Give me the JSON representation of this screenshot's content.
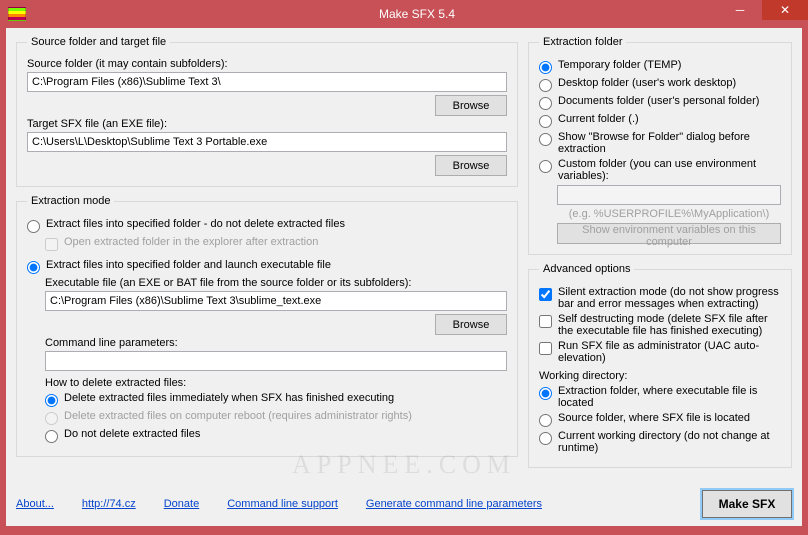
{
  "window": {
    "title": "Make SFX 5.4"
  },
  "source_target": {
    "legend": "Source folder and target file",
    "source_label": "Source folder (it may contain subfolders):",
    "source_value": "C:\\Program Files (x86)\\Sublime Text 3\\",
    "target_label": "Target SFX file (an EXE file):",
    "target_value": "C:\\Users\\L\\Desktop\\Sublime Text 3 Portable.exe",
    "browse": "Browse"
  },
  "extraction_mode": {
    "legend": "Extraction mode",
    "opt_nodelete": "Extract files into specified folder - do not delete extracted files",
    "open_after": "Open extracted folder in the explorer after extraction",
    "opt_launch": "Extract files into specified folder and launch executable file",
    "exe_label": "Executable file (an EXE or BAT file from the source folder or its subfolders):",
    "exe_value": "C:\\Program Files (x86)\\Sublime Text 3\\sublime_text.exe",
    "cmd_label": "Command line parameters:",
    "cmd_value": "",
    "browse": "Browse",
    "howto_label": "How to delete extracted files:",
    "del_immediately": "Delete extracted files immediately when SFX has finished executing",
    "del_reboot": "Delete extracted files on computer reboot (requires administrator rights)",
    "del_no": "Do not delete extracted files"
  },
  "extraction_folder": {
    "legend": "Extraction folder",
    "temp": "Temporary folder (TEMP)",
    "desktop": "Desktop folder (user's work desktop)",
    "documents": "Documents folder (user's personal folder)",
    "current": "Current folder (.)",
    "browse_dialog": "Show \"Browse for Folder\" dialog before extraction",
    "custom": "Custom folder (you can use environment variables):",
    "custom_placeholder": "(e.g. %USERPROFILE%\\MyApplication\\)",
    "show_env": "Show environment variables on this computer"
  },
  "advanced": {
    "legend": "Advanced options",
    "silent": "Silent extraction mode (do not show progress bar and error messages when extracting)",
    "selfdestruct": "Self destructing mode (delete SFX file after the executable file has finished executing)",
    "runadmin": "Run SFX file as administrator (UAC auto-elevation)",
    "wd_label": "Working directory:",
    "wd_extraction": "Extraction folder, where executable file is located",
    "wd_source": "Source folder, where SFX file is located",
    "wd_current": "Current working directory (do not change at runtime)"
  },
  "footer": {
    "about": "About...",
    "site": "http://74.cz",
    "donate": "Donate",
    "cmd_support": "Command line support",
    "gen_params": "Generate command line parameters",
    "make": "Make SFX"
  },
  "watermark": "APPNEE.COM"
}
